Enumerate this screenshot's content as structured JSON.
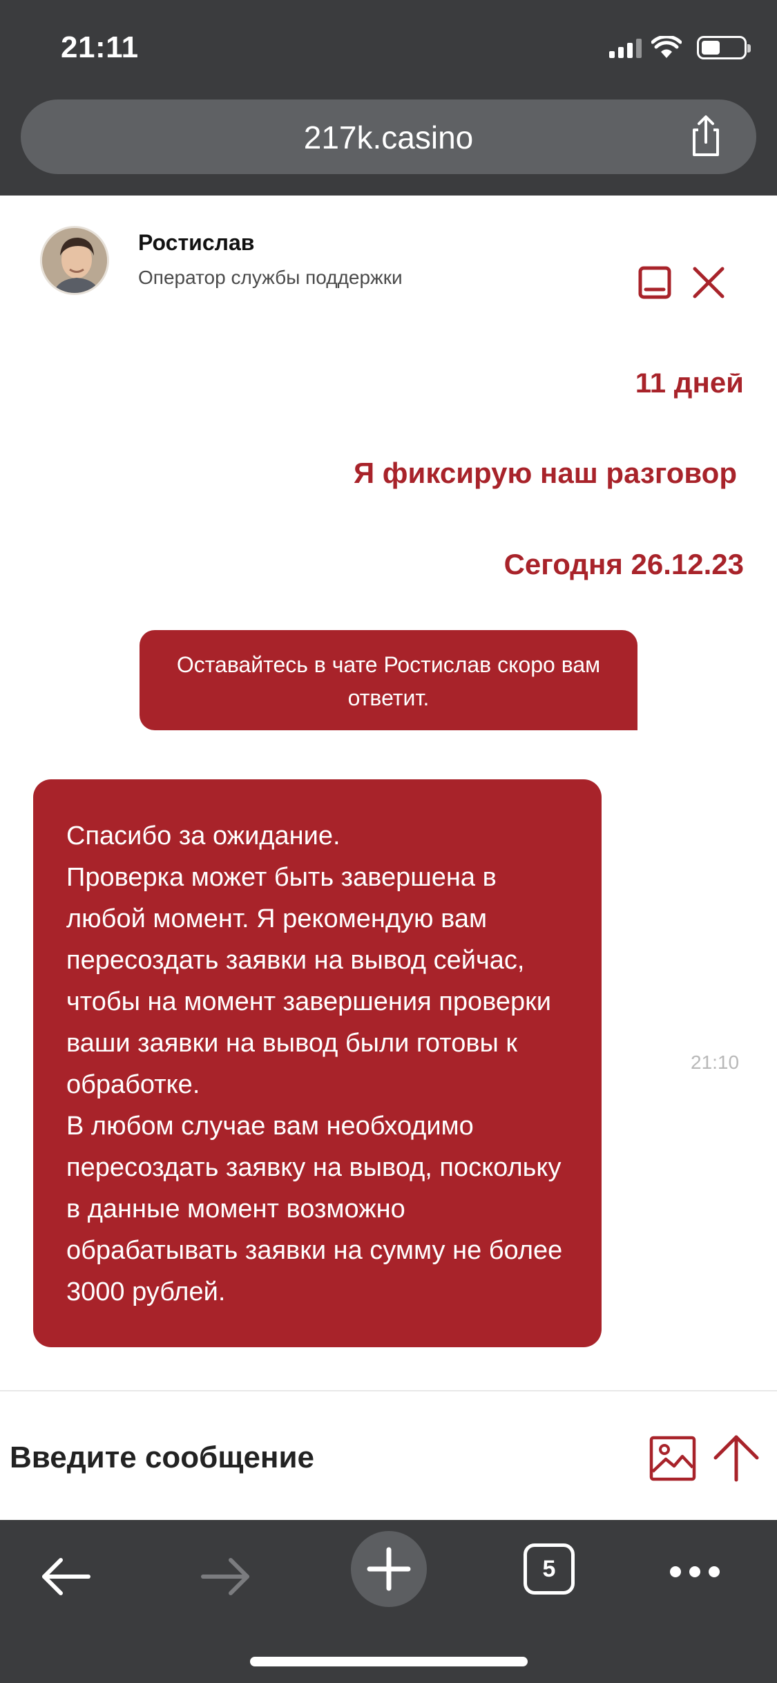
{
  "status_bar": {
    "time": "21:11"
  },
  "browser": {
    "url": "217k.casino",
    "tab_count": "5"
  },
  "chat": {
    "operator_name": "Ростислав",
    "operator_role": "Оператор службы поддержки",
    "system_lines": {
      "days": "11 дней",
      "recording": "Я фиксирую наш разговор",
      "date": "Сегодня 26.12.23"
    },
    "info_message": "Оставайтесь в чате Ростислав скоро вам ответит.",
    "operator_message": "Спасибо за ожидание.\nПроверка может быть завершена в любой момент. Я рекомендую вам пересоздать заявки на вывод сейчас, чтобы на момент завершения проверки ваши заявки на вывод были готовы к обработке.\nВ любом случае вам необходимо пересоздать заявку на вывод, поскольку в данные момент возможно обрабатывать заявки на сумму не более 3000 рублей.",
    "operator_message_time": "21:10",
    "input_placeholder": "Введите сообщение"
  },
  "colors": {
    "accent": "#a8232a",
    "chrome": "#3b3c3e",
    "url_bar": "#5f6164"
  },
  "icons": {
    "share": "share-icon",
    "minimize": "minimize-icon",
    "close": "close-icon",
    "image": "image-icon",
    "send": "arrow-up-icon",
    "back": "arrow-left-icon",
    "forward": "arrow-right-icon",
    "new_tab": "plus-icon",
    "more": "ellipsis-icon"
  }
}
